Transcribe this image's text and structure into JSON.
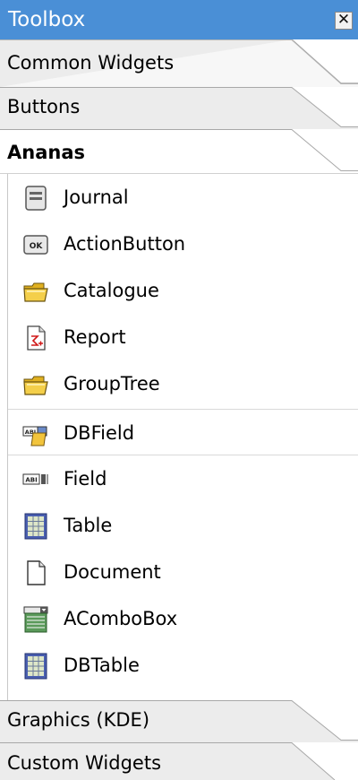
{
  "window": {
    "title": "Toolbox",
    "close_label": "✕"
  },
  "tabs": {
    "common": "Common Widgets",
    "buttons": "Buttons",
    "ananas": "Ananas",
    "graphics": "Graphics (KDE)",
    "custom": "Custom Widgets"
  },
  "ananas_items": [
    {
      "label": "Journal",
      "icon": "journal-icon"
    },
    {
      "label": "ActionButton",
      "icon": "ok-button-icon"
    },
    {
      "label": "Catalogue",
      "icon": "folder-icon"
    },
    {
      "label": "Report",
      "icon": "report-icon"
    },
    {
      "label": "GroupTree",
      "icon": "folder-icon"
    },
    {
      "label": "DBField",
      "icon": "dbfield-icon"
    },
    {
      "label": "Field",
      "icon": "field-icon"
    },
    {
      "label": "Table",
      "icon": "table-icon"
    },
    {
      "label": "Document",
      "icon": "document-icon"
    },
    {
      "label": "AComboBox",
      "icon": "combobox-icon"
    },
    {
      "label": "DBTable",
      "icon": "table-icon"
    }
  ],
  "selected_item": "DBField",
  "colors": {
    "titlebar": "#4a8fd6",
    "tab_bg": "#ececec",
    "panel_bg": "#ffffff"
  }
}
